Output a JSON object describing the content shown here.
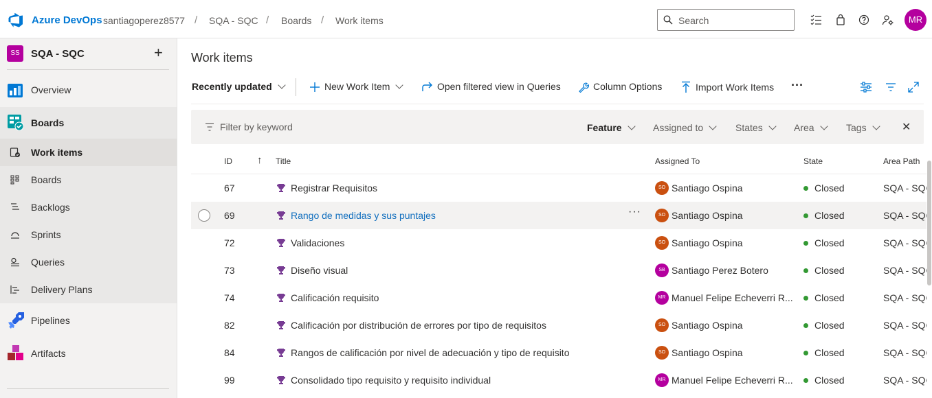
{
  "header": {
    "brand": "Azure DevOps",
    "breadcrumb": [
      "santiagoperez8577",
      "SQA - SQC",
      "Boards",
      "Work items"
    ],
    "search_placeholder": "Search",
    "avatar_initials": "MR"
  },
  "sidebar": {
    "project_badge": "SS",
    "project_name": "SQA - SQC",
    "add_symbol": "+",
    "items": [
      {
        "label": "Overview",
        "icon": "overview-icon"
      },
      {
        "label": "Boards",
        "icon": "boards-icon"
      },
      {
        "label": "Work items",
        "icon": "work-items-icon"
      },
      {
        "label": "Boards",
        "icon": "kanban-icon"
      },
      {
        "label": "Backlogs",
        "icon": "backlogs-icon"
      },
      {
        "label": "Sprints",
        "icon": "sprints-icon"
      },
      {
        "label": "Queries",
        "icon": "queries-icon"
      },
      {
        "label": "Delivery Plans",
        "icon": "delivery-plans-icon"
      },
      {
        "label": "Pipelines",
        "icon": "pipelines-icon"
      },
      {
        "label": "Artifacts",
        "icon": "artifacts-icon"
      }
    ]
  },
  "main": {
    "title": "Work items",
    "toolbar": {
      "view": "Recently updated",
      "new_item": "New Work Item",
      "open_queries": "Open filtered view in Queries",
      "column_options": "Column Options",
      "import": "Import Work Items",
      "more": "···"
    },
    "filter": {
      "placeholder": "Filter by keyword",
      "type": "Feature",
      "assigned": "Assigned to",
      "states": "States",
      "area": "Area",
      "tags": "Tags",
      "clear": "✕"
    },
    "columns": {
      "id": "ID",
      "sort": "↑",
      "title": "Title",
      "assigned": "Assigned To",
      "state": "State",
      "area": "Area Path"
    },
    "rows": [
      {
        "id": "67",
        "title": "Registrar Requisitos",
        "avatar": "SO",
        "assigned": "Santiago Ospina",
        "state": "Closed",
        "area": "SQA - SQC"
      },
      {
        "id": "69",
        "title": "Rango de medidas y sus puntajes",
        "avatar": "SO",
        "assigned": "Santiago Ospina",
        "state": "Closed",
        "area": "SQA - SQC",
        "more": "···"
      },
      {
        "id": "72",
        "title": "Validaciones",
        "avatar": "SO",
        "assigned": "Santiago Ospina",
        "state": "Closed",
        "area": "SQA - SQC"
      },
      {
        "id": "73",
        "title": "Diseño visual",
        "avatar": "SB",
        "assigned": "Santiago Perez Botero",
        "state": "Closed",
        "area": "SQA - SQC"
      },
      {
        "id": "74",
        "title": "Calificación requisito",
        "avatar": "MR",
        "assigned": "Manuel Felipe Echeverri R...",
        "state": "Closed",
        "area": "SQA - SQC"
      },
      {
        "id": "82",
        "title": "Calificación por distribución de errores por tipo de requisitos",
        "avatar": "SO",
        "assigned": "Santiago Ospina",
        "state": "Closed",
        "area": "SQA - SQC"
      },
      {
        "id": "84",
        "title": "Rangos de calificación por nivel de adecuación y tipo de requisito",
        "avatar": "SO",
        "assigned": "Santiago Ospina",
        "state": "Closed",
        "area": "SQA - SQC"
      },
      {
        "id": "99",
        "title": "Consolidado tipo requisito y requisito individual",
        "avatar": "MR",
        "assigned": "Manuel Felipe Echeverri R...",
        "state": "Closed",
        "area": "SQA - SQC"
      }
    ]
  },
  "colors": {
    "brand": "#0078d4",
    "avatar_SO": "#ca5010",
    "avatar_SB": "#b4009e",
    "avatar_MR": "#b4009e",
    "closed": "#339933",
    "feature_icon": "#773b93"
  }
}
